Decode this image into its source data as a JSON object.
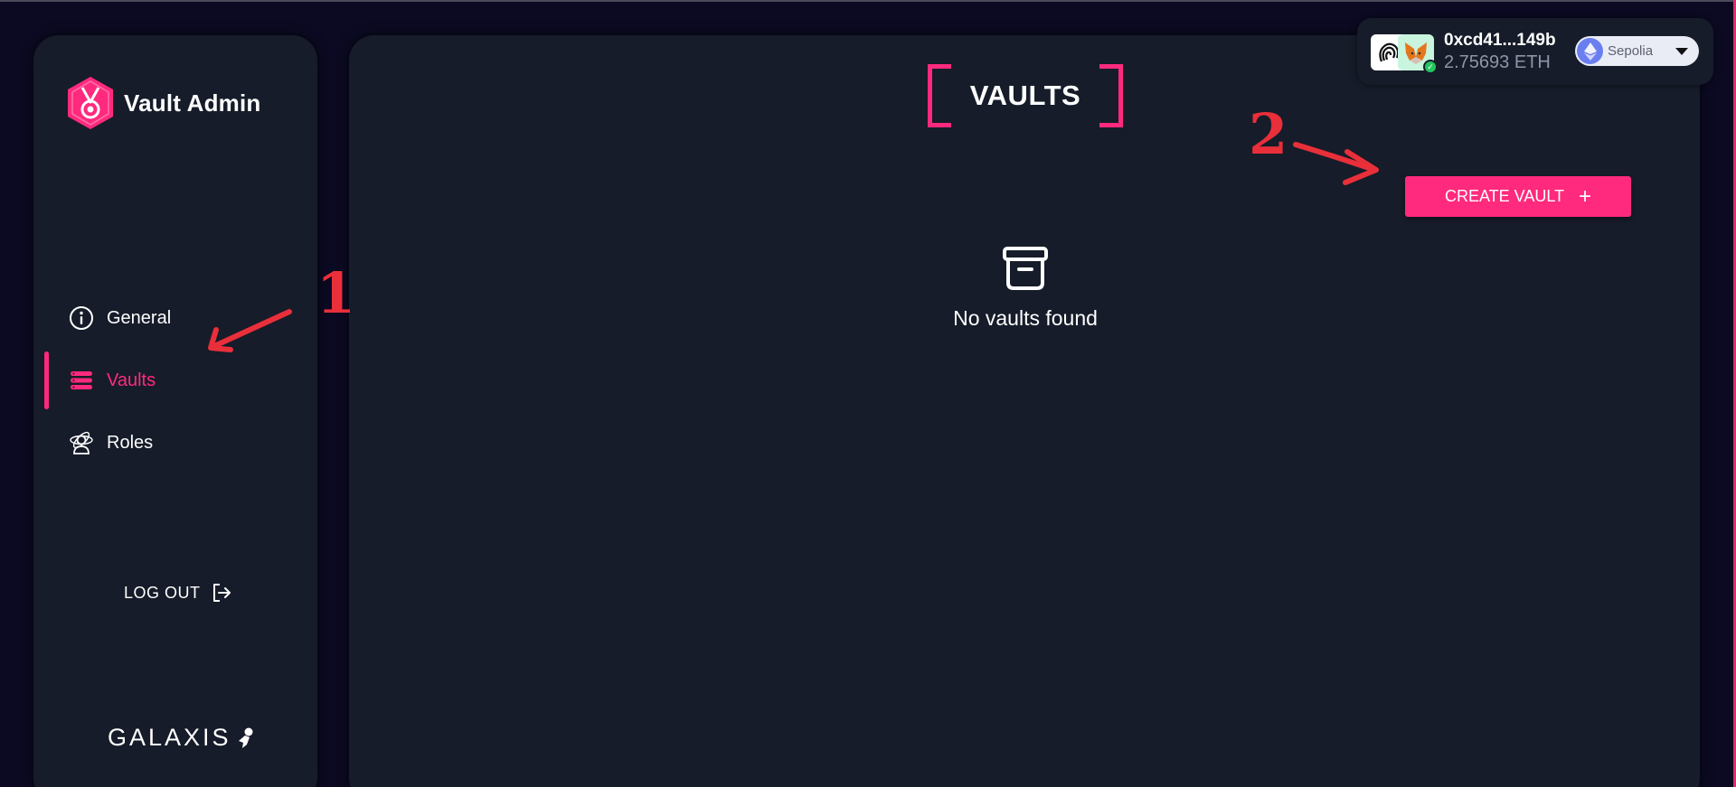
{
  "app": {
    "brand_name": "Vault Admin",
    "accent_color": "#ff2a7d"
  },
  "sidebar": {
    "items": [
      {
        "label": "General",
        "icon": "info-circle-icon",
        "active": false
      },
      {
        "label": "Vaults",
        "icon": "server-stack-icon",
        "active": true
      },
      {
        "label": "Roles",
        "icon": "roles-icon",
        "active": false
      }
    ],
    "logout_label": "LOG OUT",
    "footer_logo": "GALAXIS"
  },
  "main": {
    "title": "VAULTS",
    "create_button_label": "CREATE VAULT",
    "create_button_icon": "+",
    "empty_text": "No vaults found"
  },
  "wallet": {
    "address": "0xcd41...149b",
    "balance": "2.75693 ETH",
    "network": "Sepolia"
  },
  "annotations": {
    "marker_1": "1",
    "marker_2": "2",
    "color": "#e92f3a"
  }
}
